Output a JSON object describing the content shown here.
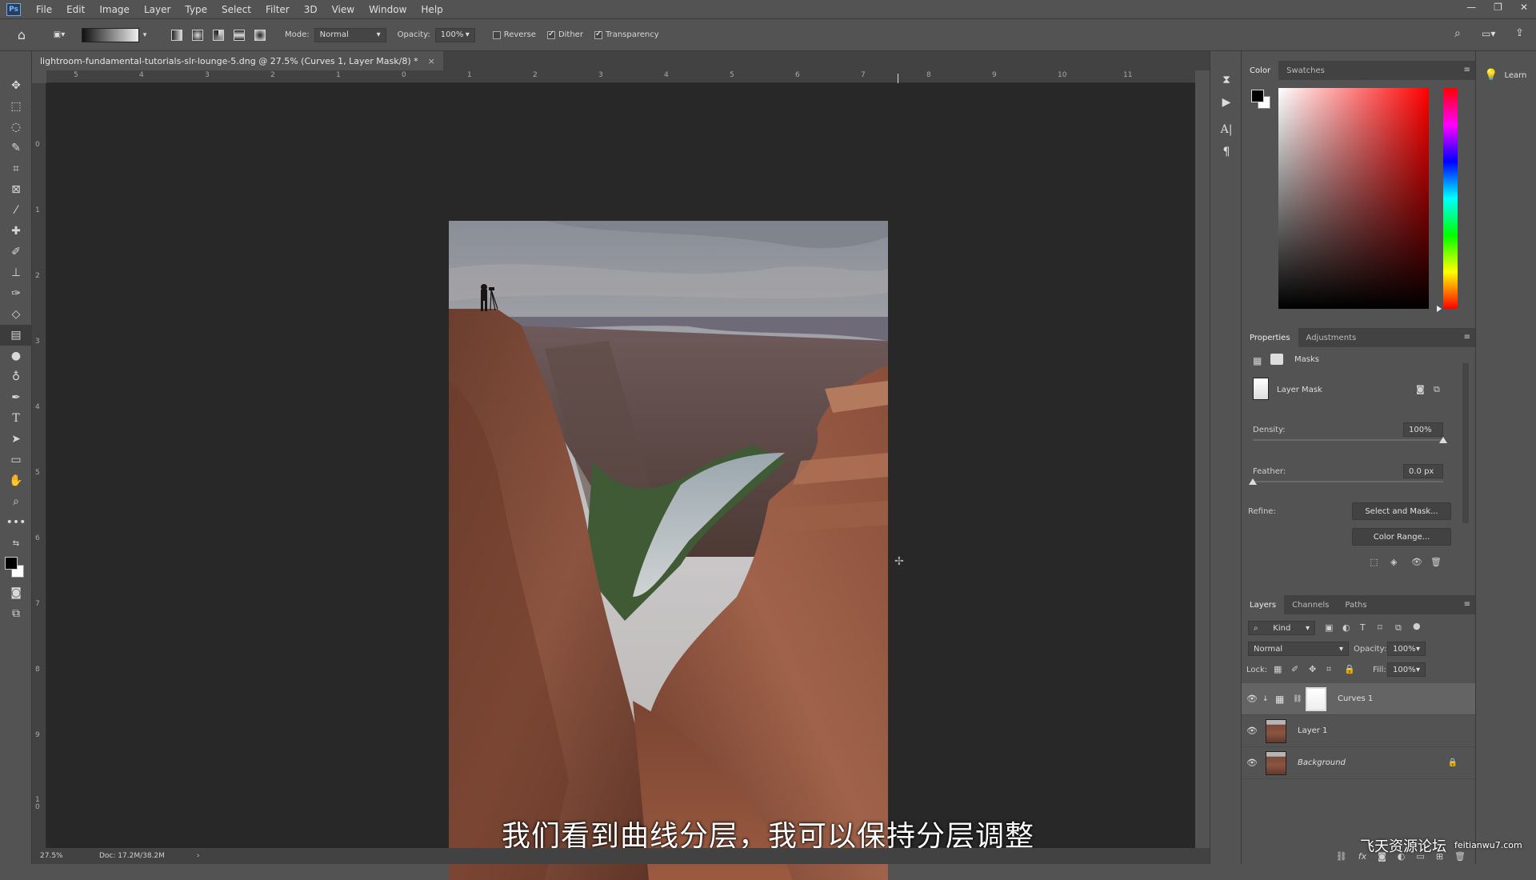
{
  "menubar": {
    "logo": "Ps",
    "items": [
      "File",
      "Edit",
      "Image",
      "Layer",
      "Type",
      "Select",
      "Filter",
      "3D",
      "View",
      "Window",
      "Help"
    ]
  },
  "options": {
    "mode_label": "Mode:",
    "mode_value": "Normal",
    "opacity_label": "Opacity:",
    "opacity_value": "100%",
    "reverse_label": "Reverse",
    "dither_label": "Dither",
    "transparency_label": "Transparency",
    "reverse_checked": false,
    "dither_checked": true,
    "transparency_checked": true
  },
  "document": {
    "tab_title": "lightroom-fundamental-tutorials-slr-lounge-5.dng @ 27.5% (Curves 1, Layer Mask/8) *",
    "close": "×",
    "zoom": "27.5%",
    "doc_size": "Doc: 17.2M/38.2M",
    "ruler_top": [
      "5",
      "4",
      "3",
      "2",
      "1",
      "0",
      "1",
      "2",
      "3",
      "4",
      "5",
      "6",
      "7",
      "8",
      "9",
      "10",
      "11"
    ],
    "ruler_left": [
      "0",
      "1",
      "2",
      "3",
      "4",
      "5",
      "6",
      "7",
      "8",
      "9",
      "1\n0"
    ]
  },
  "subtitle": "我们看到曲线分层，我可以保持分层调整",
  "color_panel": {
    "tabs": [
      "Color",
      "Swatches"
    ],
    "active_tab": "Color",
    "hue_color": "#ff0000"
  },
  "properties_panel": {
    "tabs": [
      "Properties",
      "Adjustments"
    ],
    "active_tab": "Properties",
    "masks_label": "Masks",
    "layer_mask_label": "Layer Mask",
    "density_label": "Density:",
    "density_value": "100%",
    "density_fraction": 1.0,
    "feather_label": "Feather:",
    "feather_value": "0.0 px",
    "feather_fraction": 0.0,
    "refine_label": "Refine:",
    "select_and_mask": "Select and Mask...",
    "color_range": "Color Range..."
  },
  "layers_panel": {
    "tabs": [
      "Layers",
      "Channels",
      "Paths"
    ],
    "active_tab": "Layers",
    "kind_label": "Kind",
    "blend_mode": "Normal",
    "opacity_label": "Opacity:",
    "opacity_value": "100%",
    "lock_label": "Lock:",
    "fill_label": "Fill:",
    "fill_value": "100%",
    "layers": [
      {
        "name": "Curves 1",
        "selected": true,
        "type": "adjustment"
      },
      {
        "name": "Layer 1",
        "selected": false,
        "type": "image"
      },
      {
        "name": "Background",
        "selected": false,
        "type": "image",
        "locked": true
      }
    ],
    "footer_fx": "fx"
  },
  "learn": {
    "label": "Learn"
  },
  "watermark": {
    "text": "飞天资源论坛",
    "url": "feitianwu7.com"
  }
}
